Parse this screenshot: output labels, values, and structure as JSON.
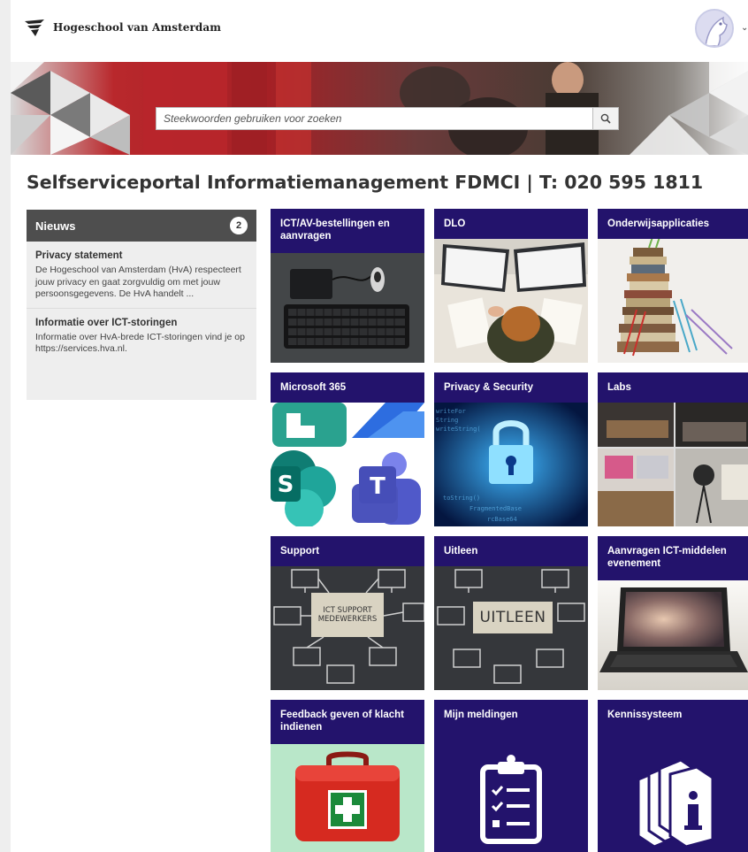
{
  "header": {
    "logo_text": "Hogeschool van Amsterdam",
    "logo_icon": "hva-logo-icon",
    "avatar_icon": "user-avatar-icon",
    "menu_caret": "chevron-down-icon"
  },
  "search": {
    "placeholder": "Steekwoorden gebruiken voor zoeken",
    "button_icon": "search-icon"
  },
  "page": {
    "title": "Selfserviceportal Informatiemanagement FDMCI | T: 020 595 1811"
  },
  "news": {
    "title": "Nieuws",
    "count": "2",
    "items": [
      {
        "title": "Privacy statement",
        "text": "De Hogeschool van Amsterdam (HvA) respecteert jouw privacy en gaat zorgvuldig om met jouw persoonsgegevens. De HvA handelt ..."
      },
      {
        "title": "Informatie over ICT-storingen",
        "text": "Informatie over HvA-brede ICT-storingen vind je op https://services.hva.nl."
      }
    ]
  },
  "tiles": [
    {
      "label": "ICT/AV-bestellingen en aanvragen"
    },
    {
      "label": "DLO"
    },
    {
      "label": "Onderwijsapplicaties"
    },
    {
      "label": "Microsoft 365"
    },
    {
      "label": "Privacy & Security"
    },
    {
      "label": "Labs"
    },
    {
      "label": "Support",
      "image_text_1": "ICT SUPPORT",
      "image_text_2": "MEDEWERKERS"
    },
    {
      "label": "Uitleen",
      "image_text": "UITLEEN"
    },
    {
      "label": "Aanvragen ICT-middelen evenement"
    },
    {
      "label": "Feedback geven of klacht indienen"
    },
    {
      "label": "Mijn meldingen"
    },
    {
      "label": "Kennissysteem"
    }
  ],
  "colors": {
    "tile_bg": "#23136c",
    "news_header": "#4e4e4e",
    "news_bg": "#eeeeee"
  }
}
